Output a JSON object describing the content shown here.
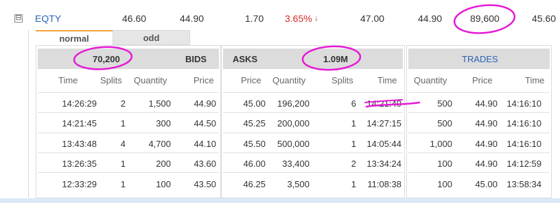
{
  "summary": {
    "symbol": "EQTY",
    "values": [
      "46.60",
      "44.90",
      "1.70"
    ],
    "change_pct": "3.65%",
    "change_arrow": "↓",
    "after": [
      "47.00",
      "44.90",
      "89,600",
      "45.60"
    ],
    "expander": "⊟"
  },
  "tabs": {
    "normal": "normal",
    "odd": "odd"
  },
  "bids": {
    "count": "70,200",
    "title": "BIDS",
    "columns": [
      "Time",
      "Splits",
      "Quantity",
      "Price"
    ],
    "rows": [
      [
        "14:26:29",
        "2",
        "1,500",
        "44.90"
      ],
      [
        "14:21:45",
        "1",
        "300",
        "44.50"
      ],
      [
        "13:43:48",
        "4",
        "4,700",
        "44.10"
      ],
      [
        "13:26:35",
        "1",
        "200",
        "43.60"
      ],
      [
        "12:33:29",
        "1",
        "100",
        "43.50"
      ]
    ]
  },
  "asks": {
    "title": "ASKS",
    "count": "1.09M",
    "columns": [
      "Price",
      "Quantity",
      "Splits",
      "Time"
    ],
    "rows": [
      [
        "45.00",
        "196,200",
        "6",
        "14:21:40"
      ],
      [
        "45.25",
        "200,000",
        "1",
        "14:27:15"
      ],
      [
        "45.50",
        "500,000",
        "1",
        "14:05:44"
      ],
      [
        "46.00",
        "33,400",
        "2",
        "13:34:24"
      ],
      [
        "46.25",
        "3,500",
        "1",
        "11:08:38"
      ]
    ]
  },
  "trades": {
    "title": "TRADES",
    "columns": [
      "Quantity",
      "Price",
      "Time"
    ],
    "rows": [
      [
        "500",
        "44.90",
        "14:16:10"
      ],
      [
        "500",
        "44.90",
        "14:16:10"
      ],
      [
        "1,000",
        "44.90",
        "14:16:10"
      ],
      [
        "100",
        "44.90",
        "14:12:59"
      ],
      [
        "100",
        "45.00",
        "13:58:34"
      ]
    ]
  },
  "colors": {
    "link": "#2a64b5",
    "down": "#d42b2b",
    "annotation": "#e619d6",
    "tab_accent": "#f5a23a"
  }
}
